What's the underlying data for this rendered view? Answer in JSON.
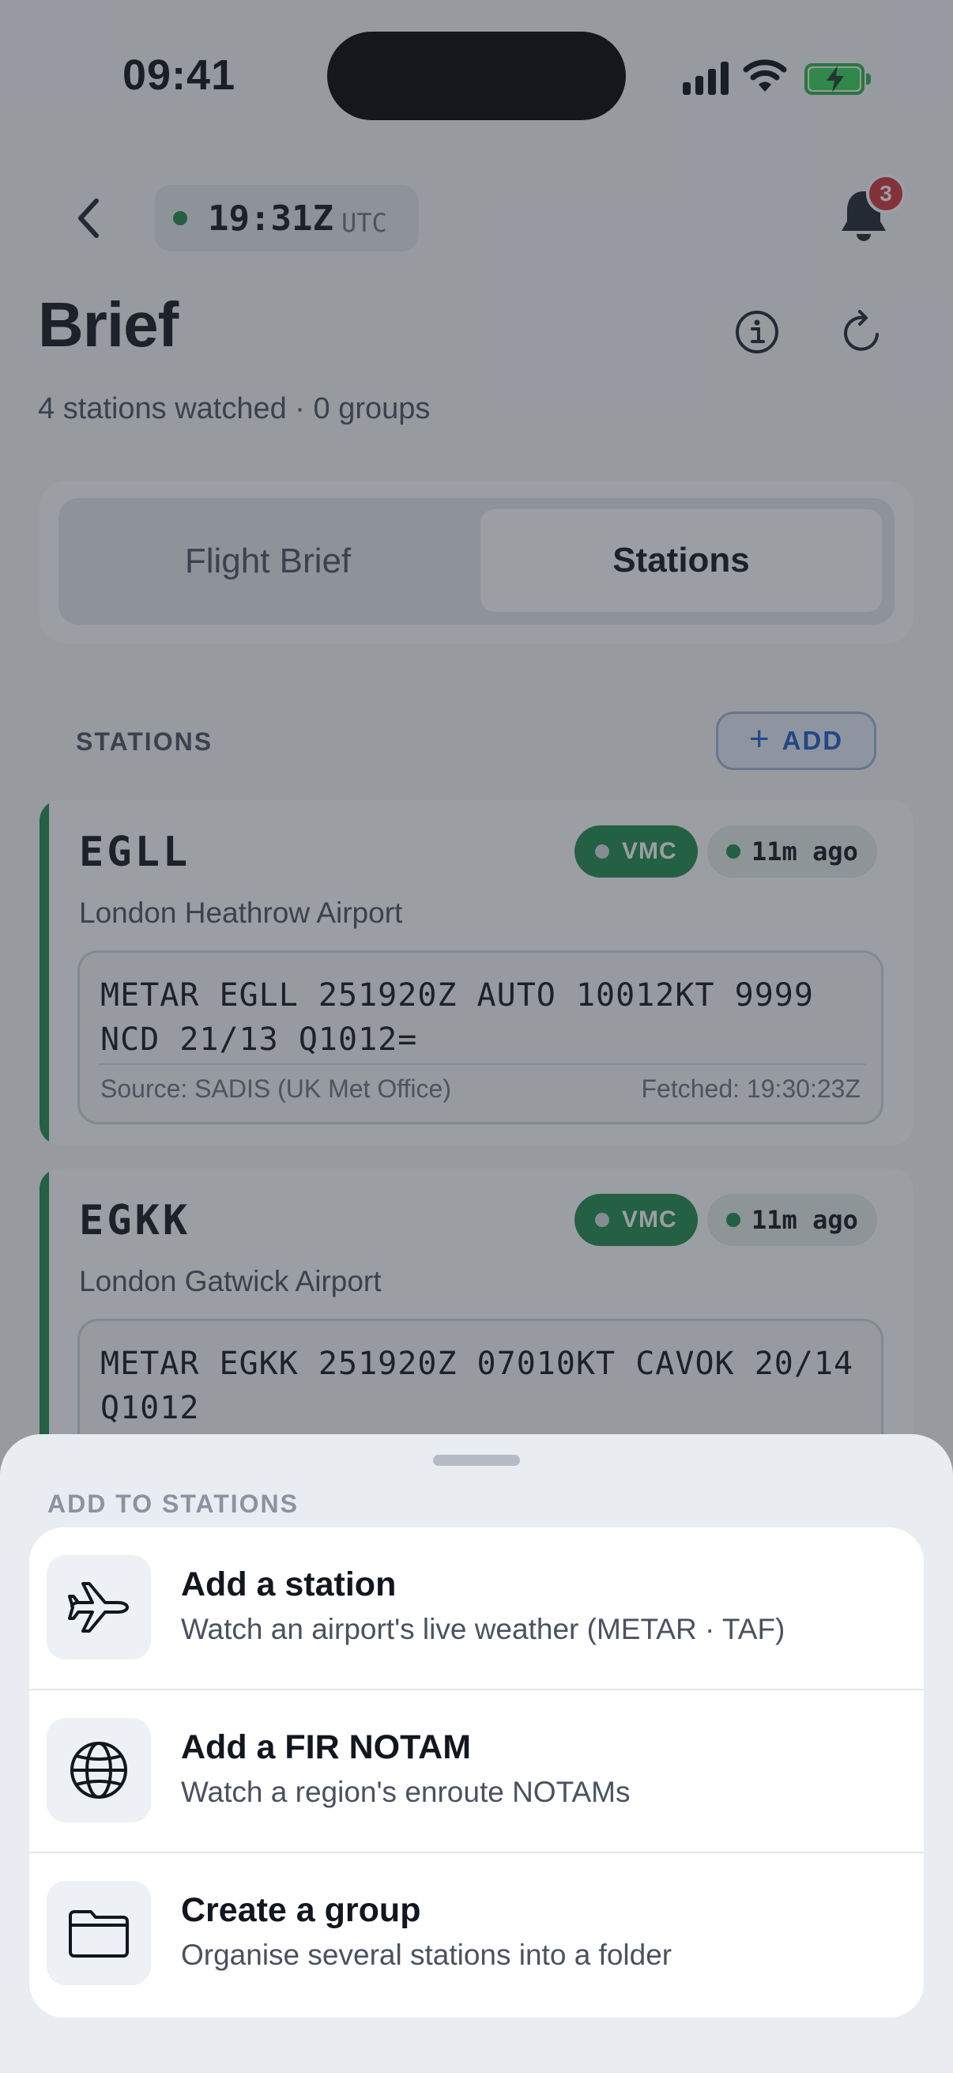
{
  "status_bar": {
    "time": "09:41"
  },
  "header": {
    "utc_time": "19:31Z",
    "utc_label": "UTC",
    "notification_count": "3",
    "title": "Brief",
    "subtitle": "4 stations watched · 0 groups"
  },
  "segmented": {
    "left": "Flight Brief",
    "right": "Stations",
    "selected": "Stations"
  },
  "stations_section": {
    "label": "STATIONS",
    "add_label": "ADD"
  },
  "stations": [
    {
      "icao": "EGLL",
      "category": "VMC",
      "age": "11m ago",
      "name": "London Heathrow Airport",
      "metar": "METAR EGLL 251920Z AUTO 10012KT 9999 NCD 21/13 Q1012=",
      "source": "Source: SADIS (UK Met Office)",
      "fetched": "Fetched: 19:30:23Z"
    },
    {
      "icao": "EGKK",
      "category": "VMC",
      "age": "11m ago",
      "name": "London Gatwick Airport",
      "metar": "METAR EGKK 251920Z 07010KT CAVOK 20/14 Q1012",
      "source": "",
      "fetched": ""
    }
  ],
  "sheet": {
    "heading": "ADD TO STATIONS",
    "options": [
      {
        "icon": "airplane-icon",
        "title": "Add a station",
        "desc": "Watch an airport's live weather (METAR · TAF)"
      },
      {
        "icon": "globe-icon",
        "title": "Add a FIR NOTAM",
        "desc": "Watch a region's enroute NOTAMs"
      },
      {
        "icon": "folder-icon",
        "title": "Create a group",
        "desc": "Organise several stations into a folder"
      }
    ]
  },
  "colors": {
    "vmc_green": "#1f8a4c",
    "accent_blue": "#1d5ccc",
    "badge_red": "#d2343d",
    "battery_green": "#39d35a"
  }
}
